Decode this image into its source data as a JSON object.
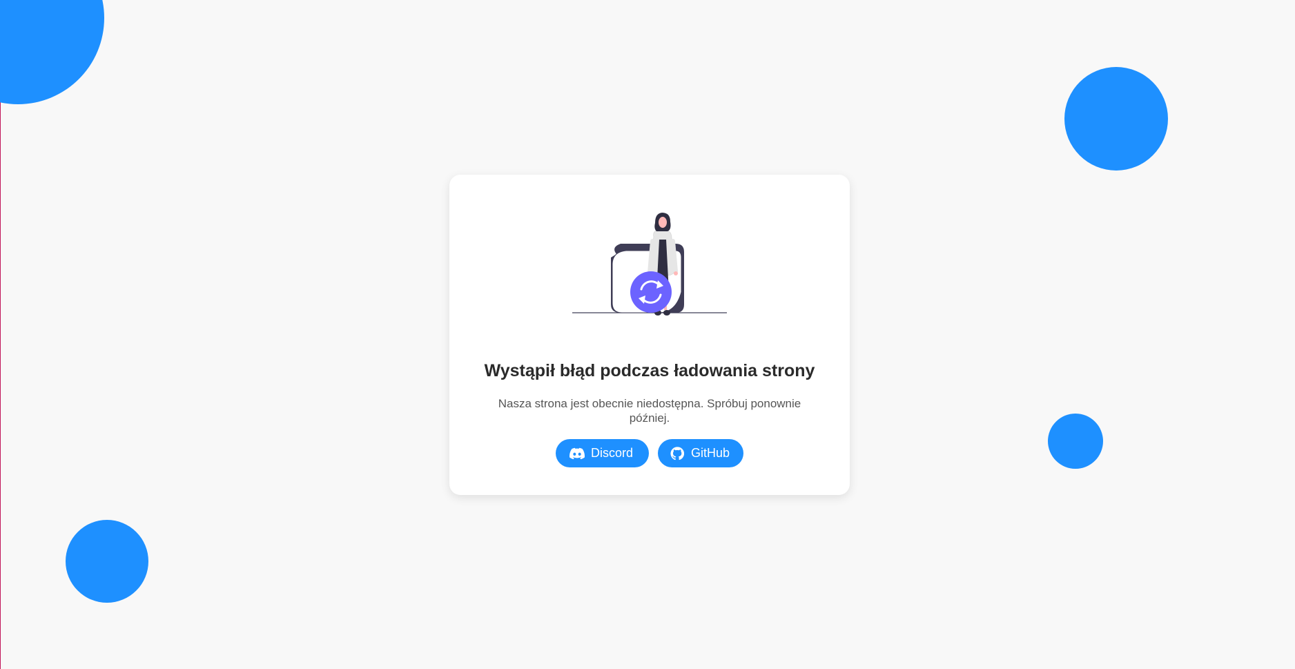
{
  "error": {
    "title": "Wystąpił błąd podczas ładowania strony",
    "message": "Nasza strona jest obecnie niedostępna. Spróbuj ponownie później."
  },
  "buttons": {
    "discord": {
      "label": "Discord",
      "icon": "discord-icon"
    },
    "github": {
      "label": "GitHub",
      "icon": "github-icon"
    }
  },
  "colors": {
    "background": "#f8f8f8",
    "accent": "#1e90ff",
    "illustration_accent": "#6c63ff",
    "card": "#ffffff"
  }
}
